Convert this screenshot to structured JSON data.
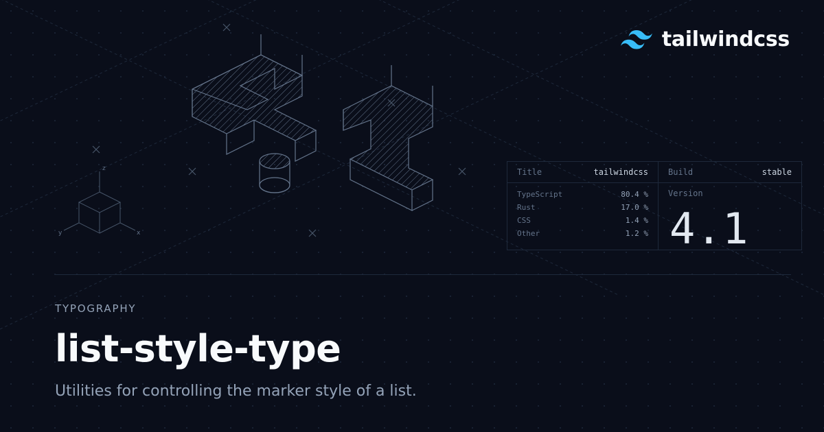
{
  "brand": {
    "name": "tailwindcss"
  },
  "info": {
    "title_label": "Title",
    "title_value": "tailwindcss",
    "build_label": "Build",
    "build_value": "stable",
    "version_label": "Version",
    "version_value": "4.1",
    "languages": [
      {
        "name": "TypeScript",
        "pct": "80.4 %"
      },
      {
        "name": "Rust",
        "pct": "17.0 %"
      },
      {
        "name": "CSS",
        "pct": "1.4 %"
      },
      {
        "name": "Other",
        "pct": "1.2 %"
      }
    ]
  },
  "content": {
    "eyebrow": "TYPOGRAPHY",
    "title": "list-style-type",
    "description": "Utilities for controlling the marker style of a list."
  },
  "axis": {
    "x": "x",
    "y": "y",
    "z": "z"
  }
}
